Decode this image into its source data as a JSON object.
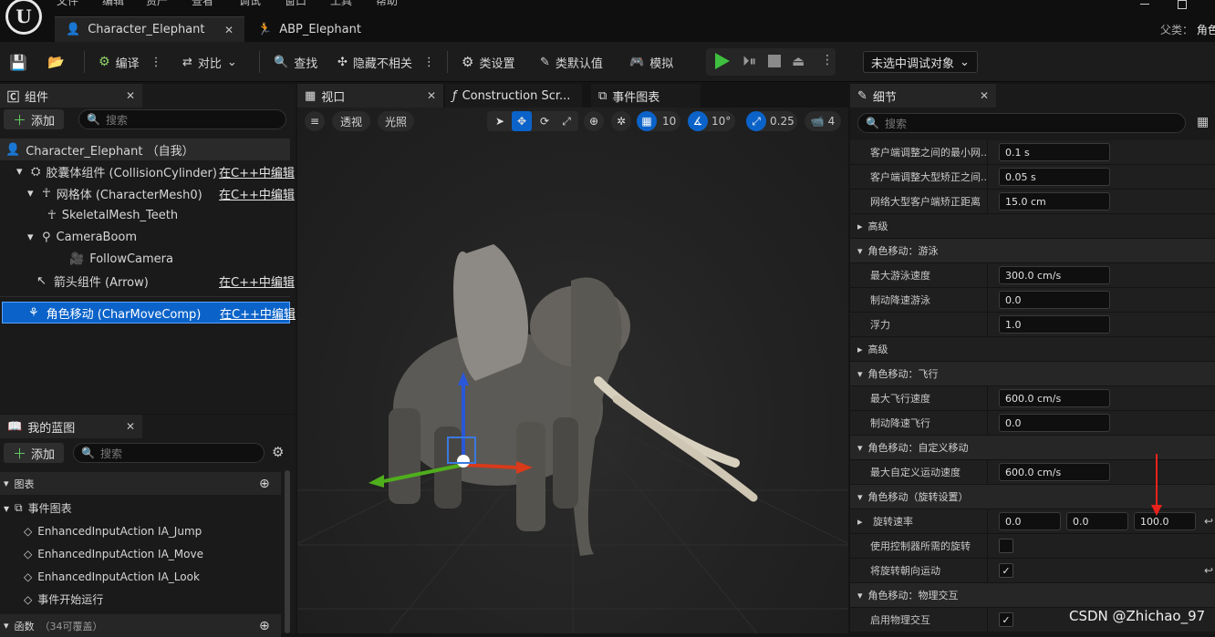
{
  "menu": [
    "文件",
    "编辑",
    "资产",
    "查看",
    "调试",
    "窗口",
    "工具",
    "帮助"
  ],
  "doc_tabs": [
    {
      "label": "Character_Elephant",
      "active": true
    },
    {
      "label": "ABP_Elephant",
      "active": false
    }
  ],
  "parent_class_label": "父类：",
  "parent_class_value": "角色",
  "toolbar": {
    "compile": "编译",
    "diff": "对比",
    "find": "查找",
    "hide_unrelated": "隐藏不相关",
    "class_settings": "类设置",
    "class_defaults": "类默认值",
    "simulate": "模拟",
    "debug_object": "未选中调试对象"
  },
  "components_panel": {
    "title": "组件",
    "add": "添加",
    "search_placeholder": "搜索",
    "root": "Character_Elephant （自我）",
    "items": [
      {
        "label": "胶囊体组件 (CollisionCylinder)",
        "edit": "在C++中编辑"
      },
      {
        "label": "网格体 (CharacterMesh0)",
        "edit": "在C++中编辑"
      },
      {
        "label": "SkeletalMesh_Teeth",
        "edit": ""
      },
      {
        "label": "CameraBoom",
        "edit": ""
      },
      {
        "label": "FollowCamera",
        "edit": ""
      },
      {
        "label": "箭头组件 (Arrow)",
        "edit": "在C++中编辑"
      },
      {
        "label": "角色移动 (CharMoveComp)",
        "edit": "在C++中编辑"
      }
    ]
  },
  "my_blueprint": {
    "title": "我的蓝图",
    "add": "添加",
    "search_placeholder": "搜索",
    "graphs_header": "图表",
    "event_graph": "事件图表",
    "events": [
      "EnhancedInputAction IA_Jump",
      "EnhancedInputAction IA_Move",
      "EnhancedInputAction IA_Look",
      "事件开始运行"
    ],
    "functions_header": "函数",
    "functions_note": "（34可覆盖）"
  },
  "center_tabs": {
    "viewport": "视口",
    "construction": "Construction Scr...",
    "event_graph": "事件图表"
  },
  "viewport": {
    "perspective": "透视",
    "lit": "光照",
    "grid_snap": "10",
    "rot_snap": "10°",
    "scale_snap": "0.25",
    "camera_speed": "4"
  },
  "details": {
    "title": "细节",
    "search_placeholder": "搜索",
    "rows": [
      {
        "type": "prop",
        "label": "客户端调整之间的最小网...",
        "value": "0.1 s"
      },
      {
        "type": "prop",
        "label": "客户端调整大型矫正之间...",
        "value": "0.05 s"
      },
      {
        "type": "prop",
        "label": "网络大型客户端矫正距离",
        "value": "15.0 cm"
      },
      {
        "type": "sub",
        "label": "高级"
      },
      {
        "type": "cat",
        "label": "角色移动：游泳"
      },
      {
        "type": "prop",
        "label": "最大游泳速度",
        "value": "300.0 cm/s"
      },
      {
        "type": "prop",
        "label": "制动降速游泳",
        "value": "0.0"
      },
      {
        "type": "prop",
        "label": "浮力",
        "value": "1.0"
      },
      {
        "type": "sub",
        "label": "高级"
      },
      {
        "type": "cat",
        "label": "角色移动：飞行"
      },
      {
        "type": "prop",
        "label": "最大飞行速度",
        "value": "600.0 cm/s"
      },
      {
        "type": "prop",
        "label": "制动降速飞行",
        "value": "0.0"
      },
      {
        "type": "cat",
        "label": "角色移动：自定义移动"
      },
      {
        "type": "prop",
        "label": "最大自定义运动速度",
        "value": "600.0 cm/s"
      },
      {
        "type": "cat",
        "label": "角色移动（旋转设置）"
      },
      {
        "type": "vec",
        "label": "旋转速率",
        "values": [
          "0.0",
          "0.0",
          "100.0"
        ]
      },
      {
        "type": "check",
        "label": "使用控制器所需的旋转",
        "checked": false
      },
      {
        "type": "check",
        "label": "将旋转朝向运动",
        "checked": true
      },
      {
        "type": "cat",
        "label": "角色移动：物理交互"
      },
      {
        "type": "check",
        "label": "启用物理交互",
        "checked": true
      }
    ]
  },
  "watermark": "CSDN @Zhichao_97"
}
